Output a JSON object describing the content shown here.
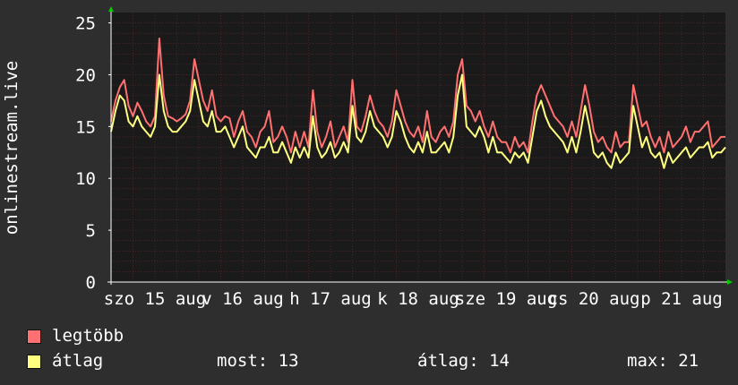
{
  "chart_data": {
    "type": "line",
    "ylabel": "onlinestream.live",
    "ylim": [
      0,
      26
    ],
    "yticks": [
      0,
      5,
      10,
      15,
      20,
      25
    ],
    "grid": true,
    "x_tick_labels": [
      "szo 15 aug",
      "v 16 aug",
      "h 17 aug",
      "k 18 aug",
      "sze 19 aug",
      "cs 20 aug",
      "p 21 aug"
    ],
    "x_range_days": [
      0,
      7
    ],
    "series": [
      {
        "name": "legtöbb",
        "color": "#ff7070",
        "x": [
          0,
          0.05,
          0.1,
          0.15,
          0.2,
          0.25,
          0.3,
          0.35,
          0.4,
          0.45,
          0.5,
          0.55,
          0.6,
          0.65,
          0.7,
          0.75,
          0.8,
          0.85,
          0.9,
          0.95,
          1,
          1.05,
          1.1,
          1.15,
          1.2,
          1.25,
          1.3,
          1.35,
          1.4,
          1.45,
          1.5,
          1.55,
          1.6,
          1.65,
          1.7,
          1.75,
          1.8,
          1.85,
          1.9,
          1.95,
          2,
          2.05,
          2.1,
          2.15,
          2.2,
          2.25,
          2.3,
          2.35,
          2.4,
          2.45,
          2.5,
          2.55,
          2.6,
          2.65,
          2.7,
          2.75,
          2.8,
          2.85,
          2.9,
          2.95,
          3,
          3.05,
          3.1,
          3.15,
          3.2,
          3.25,
          3.3,
          3.35,
          3.4,
          3.45,
          3.5,
          3.55,
          3.6,
          3.65,
          3.7,
          3.75,
          3.8,
          3.85,
          3.9,
          3.95,
          4,
          4.05,
          4.1,
          4.15,
          4.2,
          4.25,
          4.3,
          4.35,
          4.4,
          4.45,
          4.5,
          4.55,
          4.6,
          4.65,
          4.7,
          4.75,
          4.8,
          4.85,
          4.9,
          4.95,
          5,
          5.05,
          5.1,
          5.15,
          5.2,
          5.25,
          5.3,
          5.35,
          5.4,
          5.45,
          5.5,
          5.55,
          5.6,
          5.65,
          5.7,
          5.75,
          5.8,
          5.85,
          5.9,
          5.95,
          6,
          6.05,
          6.1,
          6.15,
          6.2,
          6.25,
          6.3,
          6.35,
          6.4,
          6.45,
          6.5,
          6.55,
          6.6,
          6.65,
          6.7,
          6.75,
          6.8,
          6.85,
          6.9,
          6.95,
          7
        ],
        "values": [
          15.5,
          17.5,
          18.8,
          19.5,
          17,
          16,
          17.3,
          16.5,
          15.5,
          15,
          16,
          23.5,
          18,
          16,
          15.8,
          15.5,
          15.8,
          16.2,
          17.5,
          21.5,
          19.5,
          17.5,
          16.5,
          18.5,
          16,
          15.5,
          16,
          15.8,
          14,
          15.5,
          16.5,
          14.5,
          14,
          13,
          14.5,
          15,
          16.5,
          13.5,
          14,
          15,
          14,
          12.5,
          14.5,
          13,
          14.5,
          13,
          18.5,
          14.5,
          13,
          14,
          15.5,
          13,
          14,
          15,
          13.5,
          19.5,
          15,
          14.5,
          16,
          18,
          16.5,
          15.5,
          15,
          14,
          15.5,
          18.5,
          17,
          15.5,
          14.5,
          14,
          15,
          13.5,
          16.5,
          14,
          13.5,
          14.5,
          15,
          14,
          15.5,
          20,
          21.5,
          17,
          16.5,
          15.5,
          16.5,
          15,
          14,
          15.5,
          14,
          13.5,
          13.5,
          12.5,
          14,
          13,
          13.5,
          12.5,
          15.5,
          18,
          19,
          18,
          17,
          16,
          15.5,
          15,
          14,
          15.5,
          14,
          16.5,
          19,
          17,
          14.5,
          13.5,
          14,
          13,
          12.5,
          14.5,
          13,
          13.5,
          13.5,
          19,
          17,
          15,
          15.5,
          14,
          13,
          14,
          12.5,
          14.5,
          13,
          13.5,
          14,
          15,
          13.5,
          14.5,
          14.5,
          15,
          15.5,
          13,
          13.5,
          14,
          14
        ]
      },
      {
        "name": "átlag",
        "color": "#ffff80",
        "x": [
          0,
          0.05,
          0.1,
          0.15,
          0.2,
          0.25,
          0.3,
          0.35,
          0.4,
          0.45,
          0.5,
          0.55,
          0.6,
          0.65,
          0.7,
          0.75,
          0.8,
          0.85,
          0.9,
          0.95,
          1,
          1.05,
          1.1,
          1.15,
          1.2,
          1.25,
          1.3,
          1.35,
          1.4,
          1.45,
          1.5,
          1.55,
          1.6,
          1.65,
          1.7,
          1.75,
          1.8,
          1.85,
          1.9,
          1.95,
          2,
          2.05,
          2.1,
          2.15,
          2.2,
          2.25,
          2.3,
          2.35,
          2.4,
          2.45,
          2.5,
          2.55,
          2.6,
          2.65,
          2.7,
          2.75,
          2.8,
          2.85,
          2.9,
          2.95,
          3,
          3.05,
          3.1,
          3.15,
          3.2,
          3.25,
          3.3,
          3.35,
          3.4,
          3.45,
          3.5,
          3.55,
          3.6,
          3.65,
          3.7,
          3.75,
          3.8,
          3.85,
          3.9,
          3.95,
          4,
          4.05,
          4.1,
          4.15,
          4.2,
          4.25,
          4.3,
          4.35,
          4.4,
          4.45,
          4.5,
          4.55,
          4.6,
          4.65,
          4.7,
          4.75,
          4.8,
          4.85,
          4.9,
          4.95,
          5,
          5.05,
          5.1,
          5.15,
          5.2,
          5.25,
          5.3,
          5.35,
          5.4,
          5.45,
          5.5,
          5.55,
          5.6,
          5.65,
          5.7,
          5.75,
          5.8,
          5.85,
          5.9,
          5.95,
          6,
          6.05,
          6.1,
          6.15,
          6.2,
          6.25,
          6.3,
          6.35,
          6.4,
          6.45,
          6.5,
          6.55,
          6.6,
          6.65,
          6.7,
          6.75,
          6.8,
          6.85,
          6.9,
          6.95,
          7
        ],
        "values": [
          14.5,
          16.5,
          18,
          17.5,
          15.5,
          15,
          16,
          15,
          14.5,
          14,
          15,
          20,
          16.5,
          15,
          14.5,
          14.5,
          15,
          15.5,
          16.5,
          19.5,
          17.5,
          15.5,
          15,
          16.5,
          14.5,
          14.5,
          15,
          14,
          13,
          14,
          15,
          13,
          12.5,
          12,
          13,
          13,
          14,
          12.5,
          12.5,
          13.5,
          12.5,
          11.5,
          13,
          12,
          13,
          12,
          16,
          13,
          12,
          12.5,
          13.5,
          12,
          12.5,
          13.5,
          12.5,
          17,
          14,
          13.5,
          14.5,
          16.5,
          15,
          14.5,
          14,
          13,
          14,
          16.5,
          15.5,
          14,
          13,
          12.5,
          13.5,
          12.5,
          14.5,
          12.5,
          12.5,
          13,
          13.5,
          12.5,
          14,
          18,
          20,
          15,
          14.5,
          14,
          15,
          14,
          12.5,
          14,
          12.5,
          12.5,
          12,
          11.5,
          12.5,
          12,
          12.5,
          11.5,
          14,
          16.5,
          17.5,
          16,
          15,
          14.5,
          14,
          13.5,
          12.5,
          14,
          12.5,
          14.5,
          17,
          15,
          12.5,
          12,
          12.5,
          11.5,
          11,
          12.5,
          11.5,
          12,
          12.5,
          17,
          15,
          13,
          14,
          12.5,
          12,
          12.5,
          11,
          12.5,
          11.5,
          12,
          12.5,
          13,
          12,
          12.5,
          13,
          13,
          13.5,
          12,
          12.5,
          12.5,
          13
        ]
      }
    ],
    "legend_position": "bottom-left"
  },
  "legend": {
    "max_label": "legtöbb",
    "avg_label": "átlag",
    "now_text": "most: 13",
    "avg_text": "átlag: 14",
    "max_text": "max: 21"
  },
  "colors": {
    "background": "#2e2e2e",
    "plot_background": "#1a1a1a",
    "grid": "#6a2a2a",
    "axis": "#ffffff",
    "arrow": "#00cc00"
  }
}
